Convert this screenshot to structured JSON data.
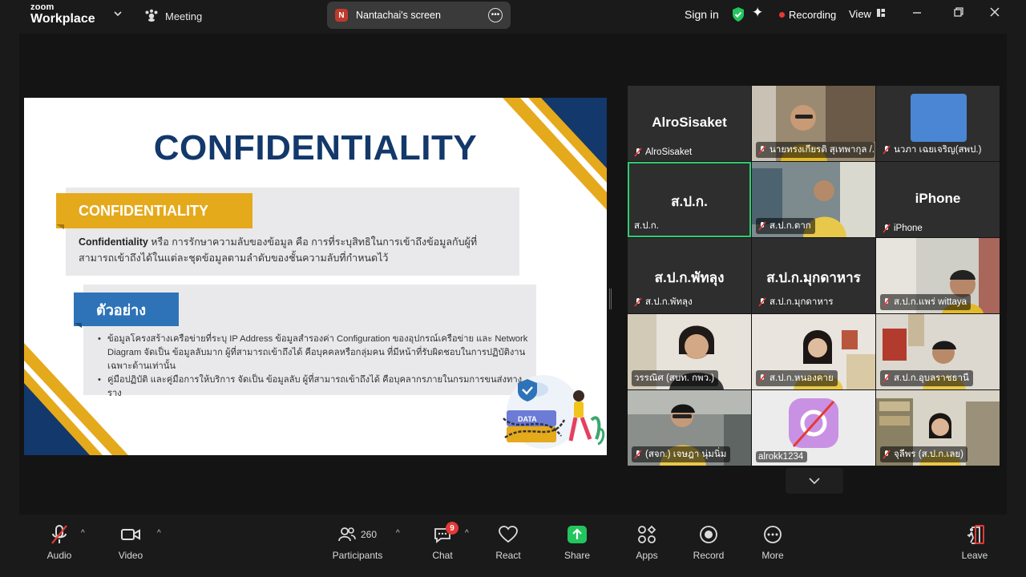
{
  "topbar": {
    "brand_small": "zoom",
    "brand_big": "Workplace",
    "meeting_label": "Meeting",
    "shared_screen_badge": "N",
    "shared_screen_label": "Nantachai's screen",
    "signin_label": "Sign in",
    "recording_label": "Recording",
    "view_label": "View"
  },
  "slide": {
    "title": "CONFIDENTIALITY",
    "section1_label": "CONFIDENTIALITY",
    "section1_term": "Confidentiality",
    "section1_text": " หรือ การรักษาความลับของข้อมูล คือ การที่ระบุสิทธิในการเข้าถึงข้อมูลกับผู้ที่สามารถเข้าถึงได้ในแต่ละชุดข้อมูลตามลำดับของชั้นความลับที่กำหนดไว้",
    "section2_label": "ตัวอย่าง",
    "bullets": [
      "ข้อมูลโครงสร้างเครือข่ายที่ระบุ IP Address ข้อมูลสำรองค่า Configuration ของอุปกรณ์เครือข่าย และ Network Diagram จัดเป็น ข้อมูลลับมาก ผู้ที่สามารถเข้าถึงได้ คือบุคคลหรือกลุ่มคน ที่มีหน้าที่รับผิดชอบในการปฏิบัติงานเฉพาะด้านเท่านั้น",
      "คู่มือปฏิบัติ และคู่มือการให้บริการ จัดเป็น ข้อมูลลับ ผู้ที่สามารถเข้าถึงได้ คือบุคลากรภายในกรมการขนส่งทางราง"
    ],
    "illustration_label": "DATA"
  },
  "participants": [
    {
      "center": "AlroSisaket",
      "caption": "AlroSisaket"
    },
    {
      "center": "",
      "caption": "นายทรงเกียรติ สุเทพากุล /..."
    },
    {
      "center": "",
      "caption": "นวภา เฉยเจริญ(สพป.)"
    },
    {
      "center": "ส.ป.ก.",
      "caption": "ส.ป.ก."
    },
    {
      "center": "",
      "caption": "ส.ป.ก.ตาก"
    },
    {
      "center": "iPhone",
      "caption": "iPhone"
    },
    {
      "center": "ส.ป.ก.พัทลุง",
      "caption": "ส.ป.ก.พัทลุง"
    },
    {
      "center": "ส.ป.ก.มุกดาหาร",
      "caption": "ส.ป.ก.มุกดาหาร"
    },
    {
      "center": "",
      "caption": "ส.ป.ก.แพร่ wittaya"
    },
    {
      "center": "",
      "caption": "วรรณิศ (สบท. กพว.)"
    },
    {
      "center": "",
      "caption": "ส.ป.ก.หนองคาย"
    },
    {
      "center": "",
      "caption": "ส.ป.ก.อุบลราชธานี"
    },
    {
      "center": "",
      "caption": "(สจก.) เจษฎา นุ่มนิ่ม"
    },
    {
      "center": "",
      "caption": "alrokk1234"
    },
    {
      "center": "",
      "caption": "จุลีพร (ส.ป.ก.เลย)"
    }
  ],
  "toolbar": {
    "audio": "Audio",
    "video": "Video",
    "participants": "Participants",
    "participants_count": "260",
    "chat": "Chat",
    "chat_badge": "9",
    "react": "React",
    "share": "Share",
    "apps": "Apps",
    "record": "Record",
    "more": "More",
    "leave": "Leave"
  },
  "colors": {
    "slide_navy": "#13386b",
    "slide_gold": "#e5a91c",
    "slide_blue": "#2e73b8",
    "active_speaker": "#2ecc71",
    "share_green": "#22c55e",
    "leave_red": "#e53935"
  }
}
